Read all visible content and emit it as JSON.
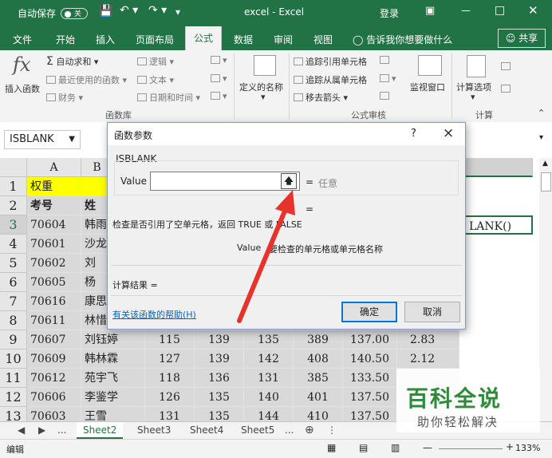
{
  "titlebar": {
    "autosave_label": "自动保存",
    "autosave_state": "关",
    "title": "excel  -  Excel",
    "login": "登录"
  },
  "tabs": [
    "文件",
    "开始",
    "插入",
    "页面布局",
    "公式",
    "数据",
    "审阅",
    "视图"
  ],
  "tell_me": "告诉我你想要做什么",
  "share": "共享",
  "ribbon": {
    "insert_function": "插入函数",
    "autosum": "自动求和",
    "recent": "最近使用的函数",
    "finance": "财务",
    "logic": "逻辑",
    "text": "文本",
    "datetime": "日期和时间",
    "defined_names": "定义的名称",
    "trace_precedents": "追踪引用单元格",
    "trace_dependents": "追踪从属单元格",
    "remove_arrows": "移去箭头",
    "watch_window": "监视窗口",
    "calc_options": "计算选项",
    "group_library": "函数库",
    "group_audit": "公式审核",
    "group_calc": "计算"
  },
  "namebox": "ISBLANK",
  "columns": [
    "A",
    "B"
  ],
  "rows": [
    {
      "num": "1",
      "a": "权重",
      "b": ""
    },
    {
      "num": "2",
      "a": "考号",
      "b": "姓"
    },
    {
      "num": "3",
      "a": "70604",
      "b": "韩雨"
    },
    {
      "num": "4",
      "a": "70601",
      "b": "沙龙"
    },
    {
      "num": "5",
      "a": "70602",
      "b": "刘"
    },
    {
      "num": "6",
      "a": "70605",
      "b": "杨"
    },
    {
      "num": "7",
      "a": "70616",
      "b": "康思"
    },
    {
      "num": "8",
      "a": "70611",
      "b": "林惜"
    },
    {
      "num": "9",
      "a": "70607",
      "b": "刘钰婷",
      "c": "115",
      "d": "139",
      "e": "135",
      "f": "389",
      "g": "137.00",
      "h": "2.83"
    },
    {
      "num": "10",
      "a": "70609",
      "b": "韩林霖",
      "c": "127",
      "d": "139",
      "e": "142",
      "f": "408",
      "g": "140.50",
      "h": "2.12"
    },
    {
      "num": "11",
      "a": "70612",
      "b": "苑宇飞",
      "c": "118",
      "d": "136",
      "e": "131",
      "f": "385",
      "g": "133.50",
      "h": ""
    },
    {
      "num": "12",
      "a": "70606",
      "b": "李鉴学",
      "c": "126",
      "d": "135",
      "e": "140",
      "f": "401",
      "g": "137.50",
      "h": ""
    },
    {
      "num": "13",
      "a": "70603",
      "b": "王雪",
      "c": "131",
      "d": "135",
      "e": "144",
      "f": "410",
      "g": "137.50",
      "h": ""
    }
  ],
  "cell_formula_tail": "LANK()",
  "sheets": [
    "Sheet2",
    "Sheet3",
    "Sheet4",
    "Sheet5"
  ],
  "sheet_more": "...",
  "status": {
    "mode": "编辑",
    "zoom": "133%"
  },
  "dialog": {
    "title": "函数参数",
    "help_q": "?",
    "close": "×",
    "func_name": "ISBLANK",
    "arg_label": "Value",
    "arg_value": "",
    "eq": "=",
    "arg_result": "任意",
    "eq2": "=",
    "description": "检查是否引用了空单元格，返回 TRUE 或 FALSE",
    "arg_desc_label": "Value",
    "arg_desc": "要检查的单元格或单元格名称",
    "result_label": "计算结果 =",
    "help_link": "有关该函数的帮助(H)",
    "ok": "确定",
    "cancel": "取消"
  },
  "watermark": {
    "main": "百科全说",
    "sub": "助你轻松解决"
  },
  "colors": {
    "excel_green": "#217346",
    "arrow_red": "#e8332a",
    "yellow": "#ffff00"
  }
}
